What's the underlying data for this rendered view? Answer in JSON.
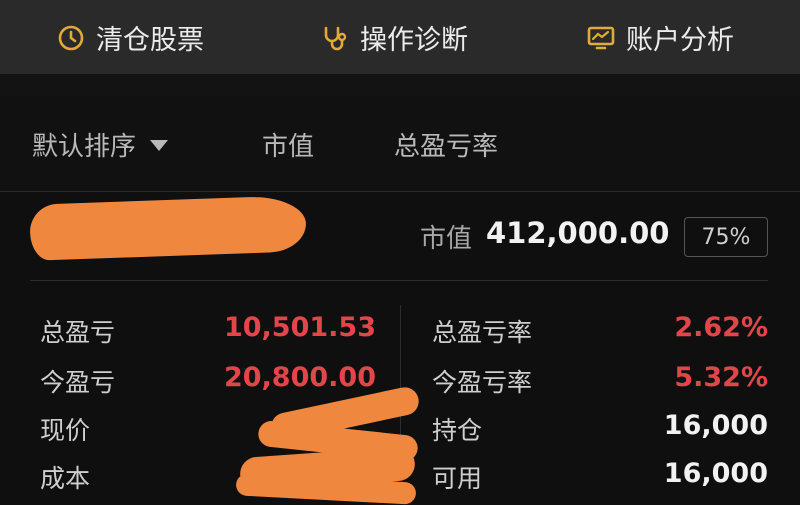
{
  "top_tabs": [
    {
      "label": "清仓股票",
      "icon": "clock-icon"
    },
    {
      "label": "操作诊断",
      "icon": "stethoscope-icon"
    },
    {
      "label": "账户分析",
      "icon": "monitor-chart-icon"
    }
  ],
  "sort_bar": {
    "default_sort": "默认排序",
    "market_value": "市值",
    "total_pl_rate": "总盈亏率"
  },
  "holding": {
    "market_value_label": "市值",
    "market_value": "412,000.00",
    "position_pct": "75%",
    "left": [
      {
        "label": "总盈亏",
        "value": "10,501.53"
      },
      {
        "label": "今盈亏",
        "value": "20,800.00"
      },
      {
        "label": "现价",
        "value": ""
      },
      {
        "label": "成本",
        "value": ""
      }
    ],
    "right": [
      {
        "label": "总盈亏率",
        "value": "2.62%"
      },
      {
        "label": "今盈亏率",
        "value": "5.32%"
      },
      {
        "label": "持仓",
        "value": "16,000"
      },
      {
        "label": "可用",
        "value": "16,000"
      }
    ]
  },
  "colors": {
    "accent_orange": "#e2a93b",
    "loss_red": "#e2464b",
    "redaction": "#f0873f"
  }
}
